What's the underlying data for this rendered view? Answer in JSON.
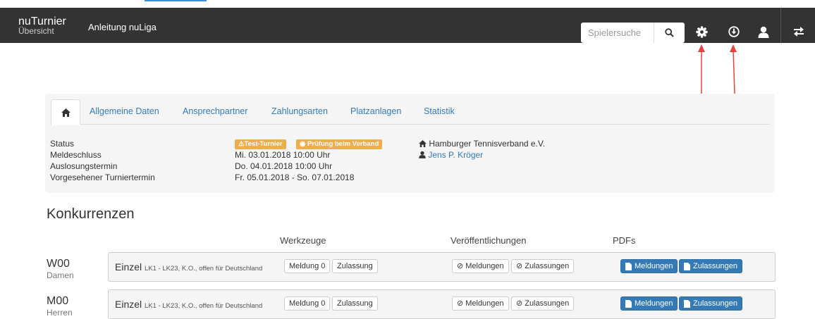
{
  "app": {
    "brand_title": "nuTurnier",
    "brand_subtitle": "Übersicht",
    "nav_link": "Anleitung nuLiga",
    "search_placeholder": "Spielersuche"
  },
  "icons": {
    "search": "search-icon",
    "settings": "gear-icon",
    "download": "download-icon",
    "user": "user-icon",
    "switch": "switch-icon",
    "home": "home-icon"
  },
  "colors": {
    "navbar": "#333333",
    "link": "#337ab7",
    "badge": "#f0ad4e",
    "arrow": "#e8423f",
    "primary_button": "#337ab7"
  },
  "tabs": [
    "Allgemeine Daten",
    "Ansprechpartner",
    "Zahlungsarten",
    "Platzanlagen",
    "Statistik"
  ],
  "details": {
    "labels": [
      "Status",
      "Meldeschluss",
      "Auslosungstermin",
      "Vorgesehener Turniertermin"
    ],
    "badges": [
      "Test-Turnier",
      "Prüfung beim Verband"
    ],
    "values": [
      "Mi. 03.01.2018 10:00 Uhr",
      "Do. 04.01.2018 10:00 Uhr",
      "Fr. 05.01.2018 - So. 07.01.2018"
    ],
    "organization": "Hamburger Tennisverband e.V.",
    "contact": "Jens P. Kröger"
  },
  "competitions": {
    "title": "Konkurrenzen",
    "columns": [
      "Werkzeuge",
      "Veröffentlichungen",
      "PDFs"
    ],
    "rows": [
      {
        "code": "W00",
        "category": "Damen",
        "type": "Einzel",
        "description": "LK1 - LK23, K.O., offen für Deutschland",
        "tool_entries": "Meldung 0",
        "tool_admission": "Zulassung",
        "pub_entries": "Meldungen",
        "pub_admissions": "Zulassungen",
        "pdf_entries": "Meldungen",
        "pdf_admissions": "Zulassungen"
      },
      {
        "code": "M00",
        "category": "Herren",
        "type": "Einzel",
        "description": "LK1 - LK23, K.O., offen für Deutschland",
        "tool_entries": "Meldung 0",
        "tool_admission": "Zulassung",
        "pub_entries": "Meldungen",
        "pub_admissions": "Zulassungen",
        "pdf_entries": "Meldungen",
        "pdf_admissions": "Zulassungen"
      }
    ]
  }
}
